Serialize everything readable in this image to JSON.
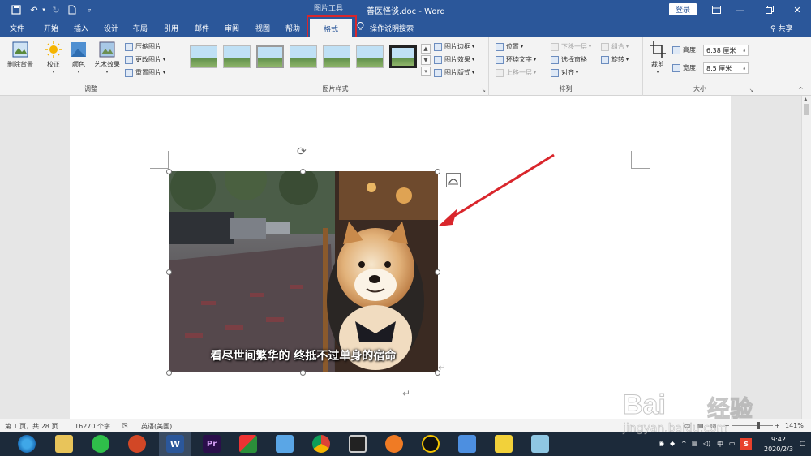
{
  "titlebar": {
    "doc_title": "善医怪谈.doc - Word",
    "context_label": "图片工具",
    "login": "登录"
  },
  "tabs": [
    "文件",
    "开始",
    "插入",
    "设计",
    "布局",
    "引用",
    "邮件",
    "审阅",
    "视图",
    "帮助",
    "格式"
  ],
  "tell_me": "操作说明搜索",
  "share": "共享",
  "ribbon": {
    "adjust": {
      "remove_bg": "删除背景",
      "corrections": "校正",
      "color": "颜色",
      "artistic": "艺术效果",
      "compress": "压缩图片",
      "change": "更改图片",
      "reset": "重置图片",
      "label": "调整"
    },
    "styles": {
      "border": "图片边框",
      "effects": "图片效果",
      "layout": "图片版式",
      "label": "图片样式"
    },
    "arrange": {
      "position": "位置",
      "wrap": "环绕文字",
      "forward": "上移一层",
      "backward": "下移一层",
      "pane": "选择窗格",
      "align": "对齐",
      "group": "组合",
      "rotate": "旋转",
      "label": "排列"
    },
    "size": {
      "crop": "裁剪",
      "height_label": "高度:",
      "height_value": "6.38 厘米",
      "width_label": "宽度:",
      "width_value": "8.5 厘米",
      "label": "大小"
    }
  },
  "image": {
    "caption": "看尽世间繁华的 终抵不过单身的宿命"
  },
  "status": {
    "page": "第 1 页，共 28 页",
    "words": "16270 个字",
    "language": "英语(美国)",
    "zoom": "141%"
  },
  "taskbar": {
    "time": "9:42",
    "date": "2020/2/3",
    "ime": "中"
  },
  "watermark": {
    "brand": "Bai",
    "brand_cn": "经验",
    "url": "jingyan.baidu.com"
  },
  "colors": {
    "accent": "#2b579a",
    "highlight": "#d9262c",
    "arrow": "#d9262c"
  }
}
